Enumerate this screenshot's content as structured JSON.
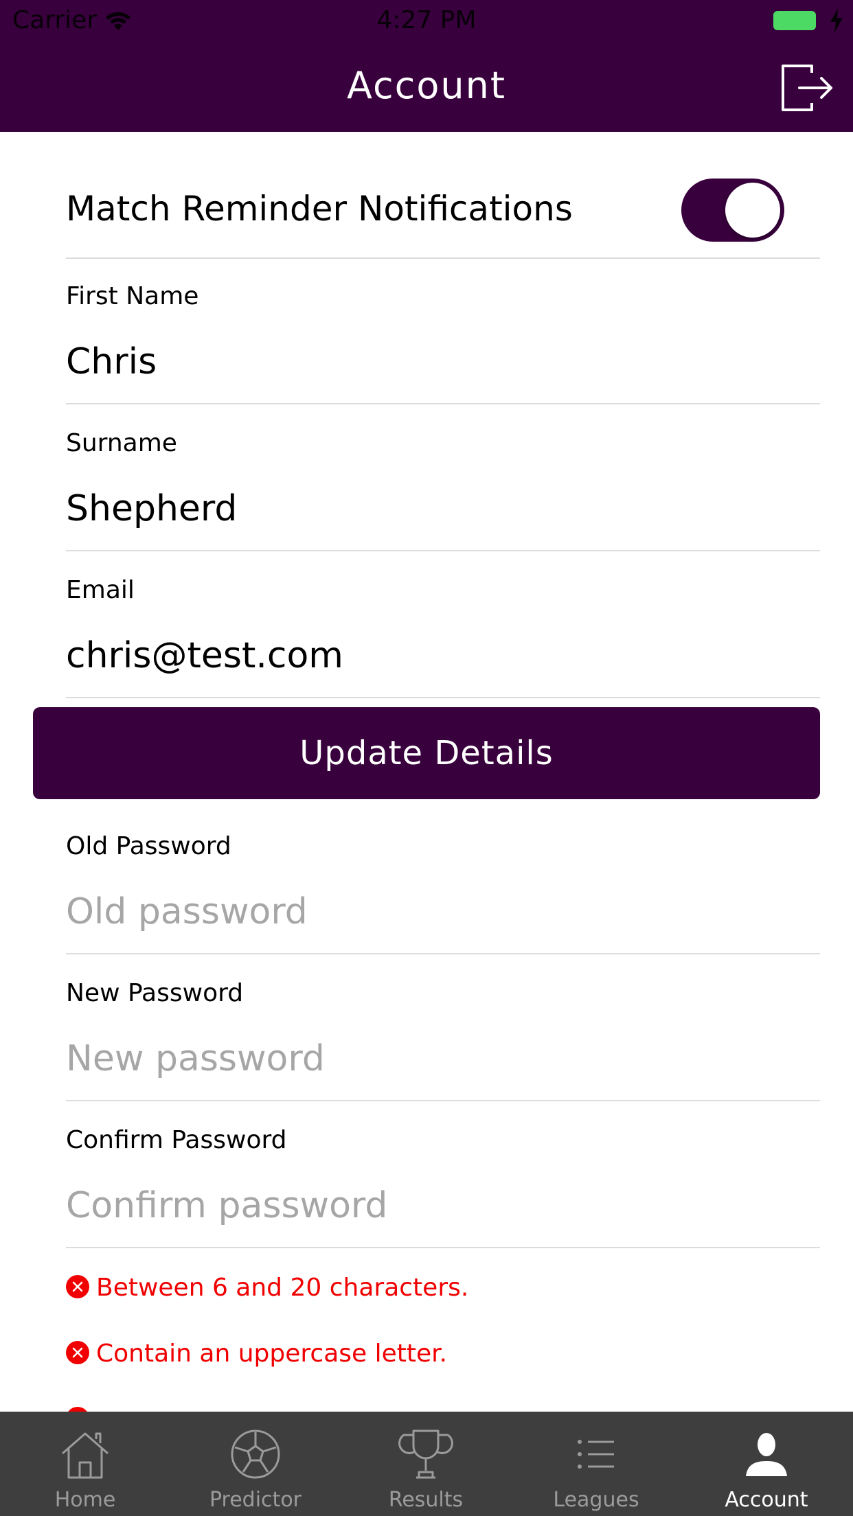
{
  "status_bar": {
    "carrier": "Carrier",
    "time": "4:27 PM",
    "battery_color": "#4cd964"
  },
  "nav": {
    "title": "Account",
    "logout_icon": "logout-icon",
    "background_color": "#38003c"
  },
  "notifications": {
    "label": "Match Reminder Notifications",
    "enabled": true
  },
  "profile": {
    "first_name": {
      "label": "First Name",
      "value": "Chris"
    },
    "surname": {
      "label": "Surname",
      "value": "Shepherd"
    },
    "email": {
      "label": "Email",
      "value": "chris@test.com"
    }
  },
  "update_button": {
    "label": "Update Details"
  },
  "password": {
    "old": {
      "label": "Old Password",
      "placeholder": "Old password"
    },
    "new": {
      "label": "New Password",
      "placeholder": "New password"
    },
    "confirm": {
      "label": "Confirm Password",
      "placeholder": "Confirm password"
    }
  },
  "password_rules": [
    {
      "text": "Between 6 and 20 characters.",
      "status": "failed"
    },
    {
      "text": "Contain an uppercase letter.",
      "status": "failed"
    }
  ],
  "error_color": "#f00000",
  "tabbar": {
    "tabs": [
      {
        "label": "Home",
        "icon": "home-icon",
        "active": false
      },
      {
        "label": "Predictor",
        "icon": "football-icon",
        "active": false
      },
      {
        "label": "Results",
        "icon": "trophy-icon",
        "active": false
      },
      {
        "label": "Leagues",
        "icon": "list-icon",
        "active": false
      },
      {
        "label": "Account",
        "icon": "user-icon",
        "active": true
      }
    ]
  }
}
